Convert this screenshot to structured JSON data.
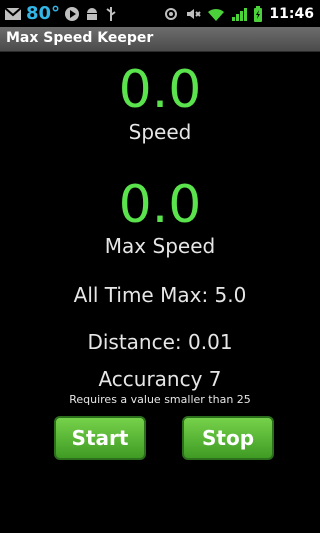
{
  "status": {
    "temperature": "80°",
    "time": "11:46",
    "icons": [
      "mail-icon",
      "play-icon",
      "android-icon",
      "usb-icon",
      "gps-icon",
      "mute-icon",
      "wifi-icon",
      "signal-icon",
      "battery-charging-icon"
    ]
  },
  "app": {
    "title": "Max Speed Keeper"
  },
  "speed": {
    "value": "0.0",
    "label": "Speed"
  },
  "max_speed": {
    "value": "0.0",
    "label": "Max Speed"
  },
  "all_time_max": {
    "label": "All Time Max:",
    "value": "5.0"
  },
  "distance": {
    "label": "Distance:",
    "value": "0.01"
  },
  "accuracy": {
    "label": "Accurancy",
    "value": "7",
    "hint": "Requires a value smaller than 25"
  },
  "buttons": {
    "start": "Start",
    "stop": "Stop"
  },
  "colors": {
    "accent_green": "#5be34d",
    "status_blue": "#33b5e5",
    "button_green": "#4fae31"
  }
}
